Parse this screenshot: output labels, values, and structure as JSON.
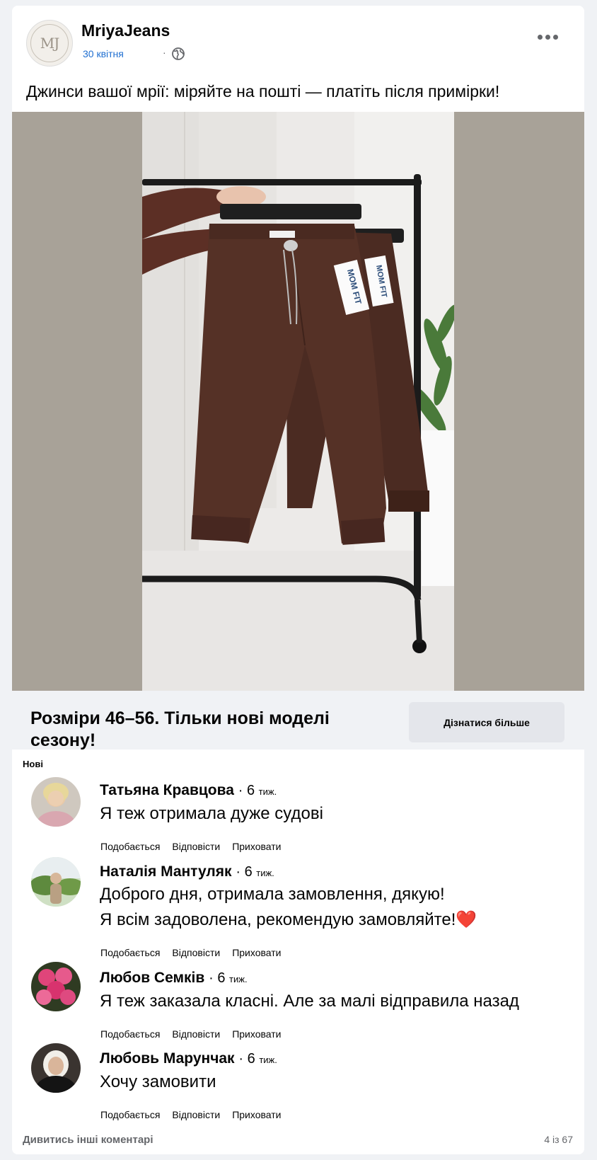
{
  "post": {
    "page_name": "MriyaJeans",
    "avatar_text": "MJ",
    "date": "30 квітня",
    "separator": "·",
    "text": "Джинси вашої мрії: міряйте на пошті — платіть після примірки!",
    "image_labels": [
      "MOM FIT",
      "MOM FIT"
    ],
    "cta_text": "Розміри 46–56. Тільки нові моделі сезону!",
    "cta_button": "Дізнатися більше"
  },
  "comments_section": {
    "filter_label": "Нові",
    "items": [
      {
        "name": "Татьяна Кравцова",
        "time_num": "6",
        "time_unit": "тиж.",
        "text_lines": [
          "Я теж отримала дуже судові"
        ]
      },
      {
        "name": "Наталія Мантуляк",
        "time_num": "6",
        "time_unit": "тиж.",
        "text_lines": [
          "Доброго дня, отримала замовлення, дякую!",
          "Я всім задоволена, рекомендую замовляйте!❤️"
        ]
      },
      {
        "name": "Любов Семків",
        "time_num": "6",
        "time_unit": "тиж.",
        "text_lines": [
          "Я теж заказала класні. Але за малі відправила назад"
        ]
      },
      {
        "name": "Любовь Марунчак",
        "time_num": "6",
        "time_unit": "тиж.",
        "text_lines": [
          "Хочу замовити"
        ]
      }
    ],
    "actions": {
      "like": "Подобається",
      "reply": "Відповісти",
      "hide": "Приховати"
    },
    "view_more": "Дивитись інші коментарі",
    "counter": "4 із 67"
  }
}
